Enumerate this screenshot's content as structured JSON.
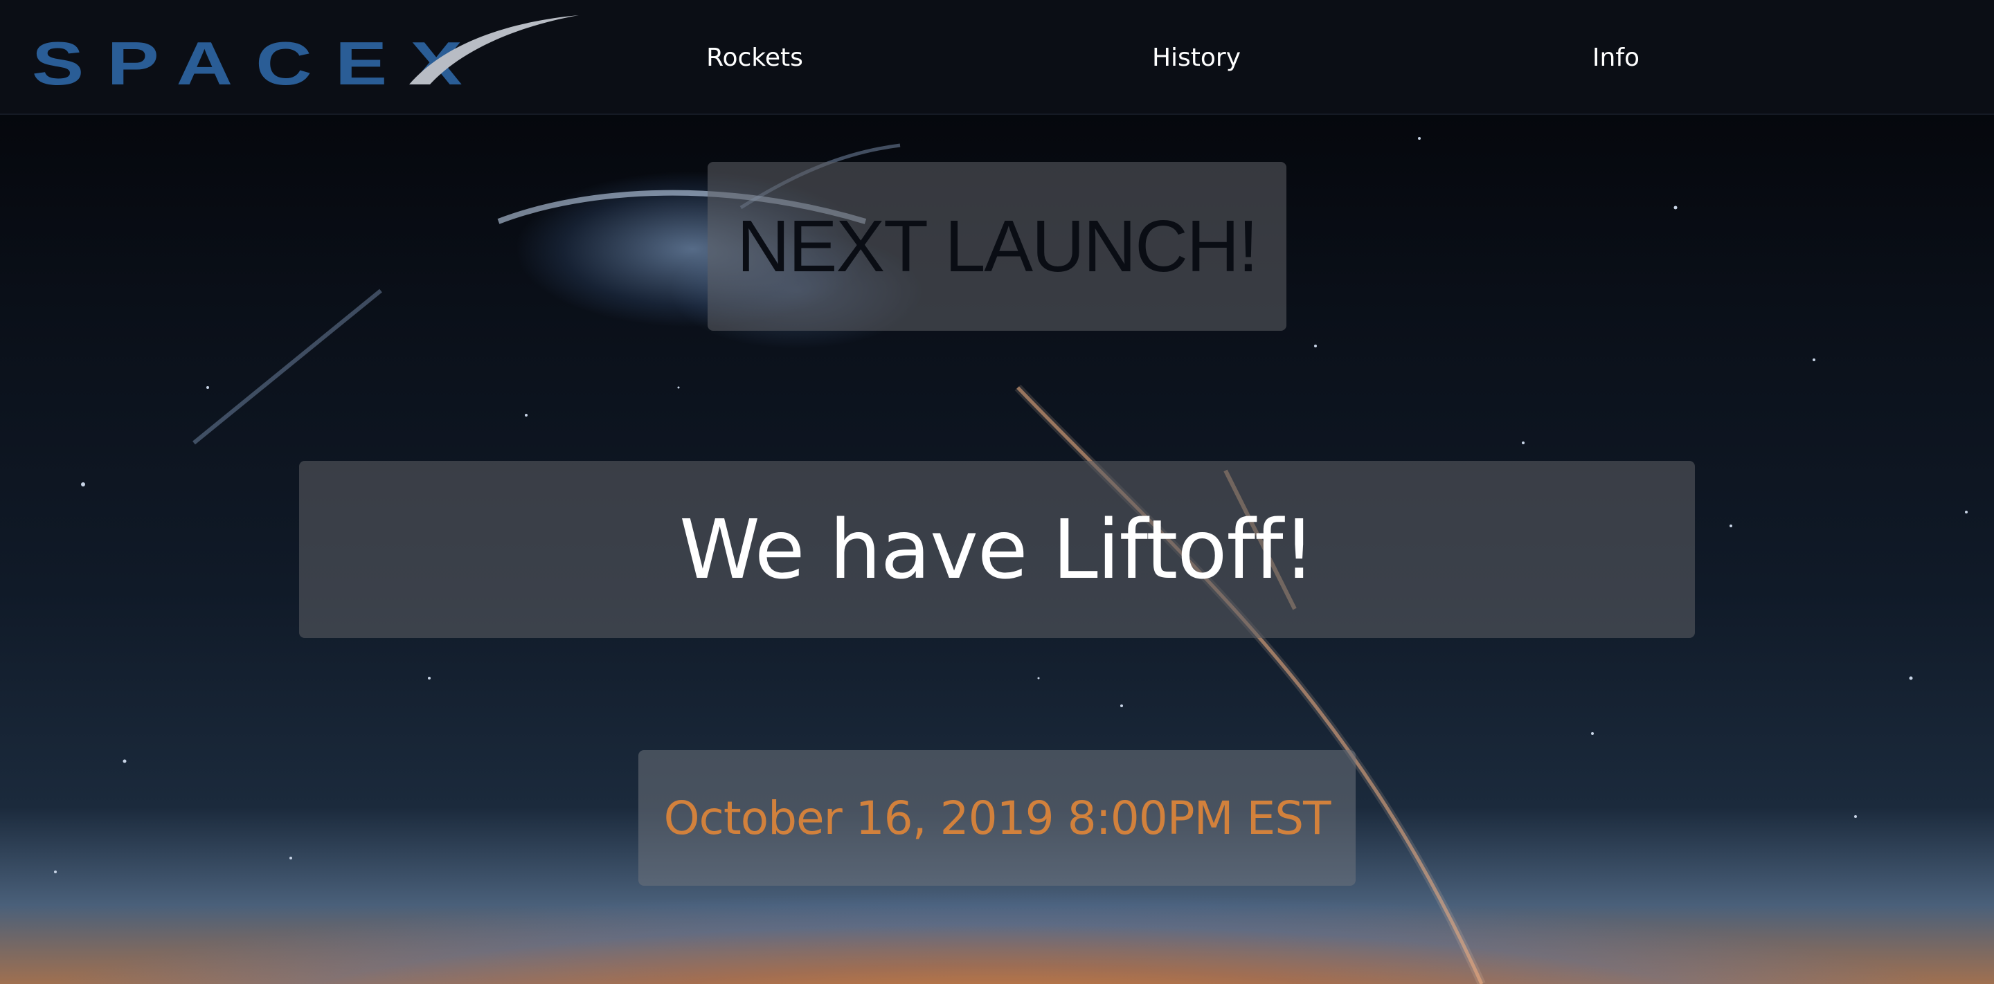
{
  "brand": {
    "logo_text": "SPACEX"
  },
  "nav": {
    "links": [
      "Rockets",
      "History",
      "Info"
    ]
  },
  "hero": {
    "heading": "NEXT LAUNCH!",
    "status": "We have Liftoff!",
    "launch_date": "October 16, 2019 8:00PM EST"
  },
  "colors": {
    "nav_bg": "#0b0e15",
    "logo_blue": "#2a5d96",
    "logo_swoosh": "#b8bcc4",
    "date_orange": "#d2813c",
    "heading_dark": "#0a0d14"
  }
}
